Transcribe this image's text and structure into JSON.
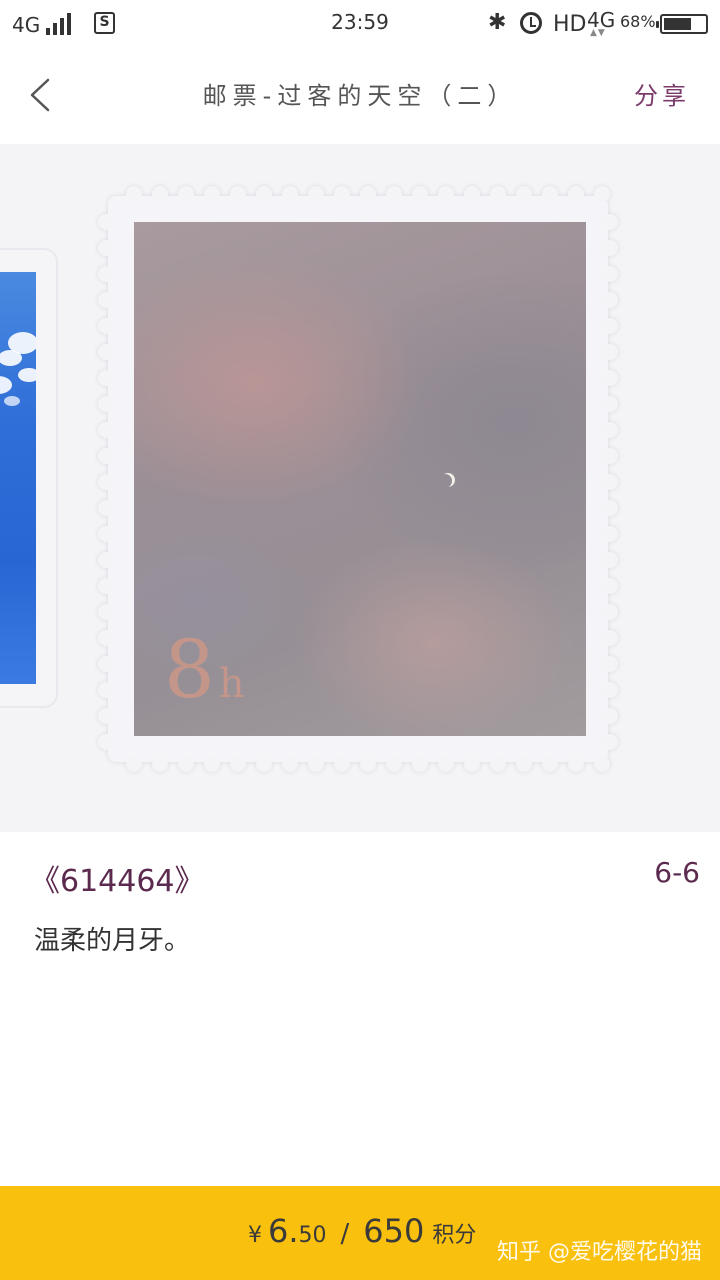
{
  "status_bar": {
    "network": "4G",
    "time": "23:59",
    "bluetooth_icon": "bluetooth-icon",
    "alarm_icon": "alarm-icon",
    "hd": "HD",
    "network2": "4G",
    "battery_percent": "68%",
    "battery_level": 0.68,
    "sim_icon_label": "S"
  },
  "header": {
    "title": "邮票-过客的天空（二）",
    "share_label": "分享",
    "back_icon": "chevron-left-icon"
  },
  "stamp": {
    "mark_big": "8",
    "mark_small": "h"
  },
  "info": {
    "code": "《614464》",
    "index": "6-6",
    "description": "温柔的月牙。"
  },
  "price": {
    "currency": "¥",
    "integer": "6.",
    "decimal": "50",
    "separator": "/",
    "points": "650",
    "points_unit": "积分"
  },
  "watermark": "知乎 @爱吃樱花的猫",
  "colors": {
    "accent": "#5b2a4e",
    "price_bar": "#f9c00d",
    "gallery_bg": "#f4f4f6"
  }
}
